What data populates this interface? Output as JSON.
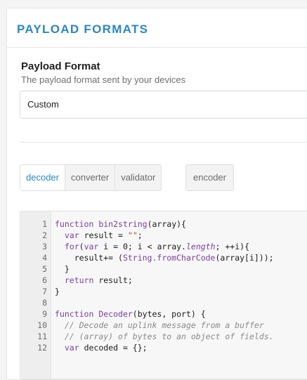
{
  "panel": {
    "title": "PAYLOAD FORMATS"
  },
  "field": {
    "label": "Payload Format",
    "description": "The payload format sent by your devices",
    "value": "Custom"
  },
  "tabs": {
    "group": [
      {
        "label": "decoder",
        "active": true
      },
      {
        "label": "converter",
        "active": false
      },
      {
        "label": "validator",
        "active": false
      }
    ],
    "solo": {
      "label": "encoder"
    }
  },
  "editor": {
    "lines": [
      {
        "n": "1",
        "code": "function bin2string(array){"
      },
      {
        "n": "2",
        "code": "  var result = \"\";"
      },
      {
        "n": "3",
        "code": "  for(var i = 0; i < array.length; ++i){"
      },
      {
        "n": "4",
        "code": "    result+= (String.fromCharCode(array[i]));"
      },
      {
        "n": "5",
        "code": "  }"
      },
      {
        "n": "6",
        "code": "  return result;"
      },
      {
        "n": "7",
        "code": "}"
      },
      {
        "n": "8",
        "code": ""
      },
      {
        "n": "9",
        "code": "function Decoder(bytes, port) {"
      },
      {
        "n": "10",
        "code": "  // Decode an uplink message from a buffer"
      },
      {
        "n": "11",
        "code": "  // (array) of bytes to an object of fields."
      },
      {
        "n": "12",
        "code": "  var decoded = {};"
      }
    ]
  },
  "colors": {
    "accent": "#2a86c4",
    "keyword": "#7a3fa0",
    "string": "#b34a2c",
    "comment": "#8a8a8a"
  }
}
